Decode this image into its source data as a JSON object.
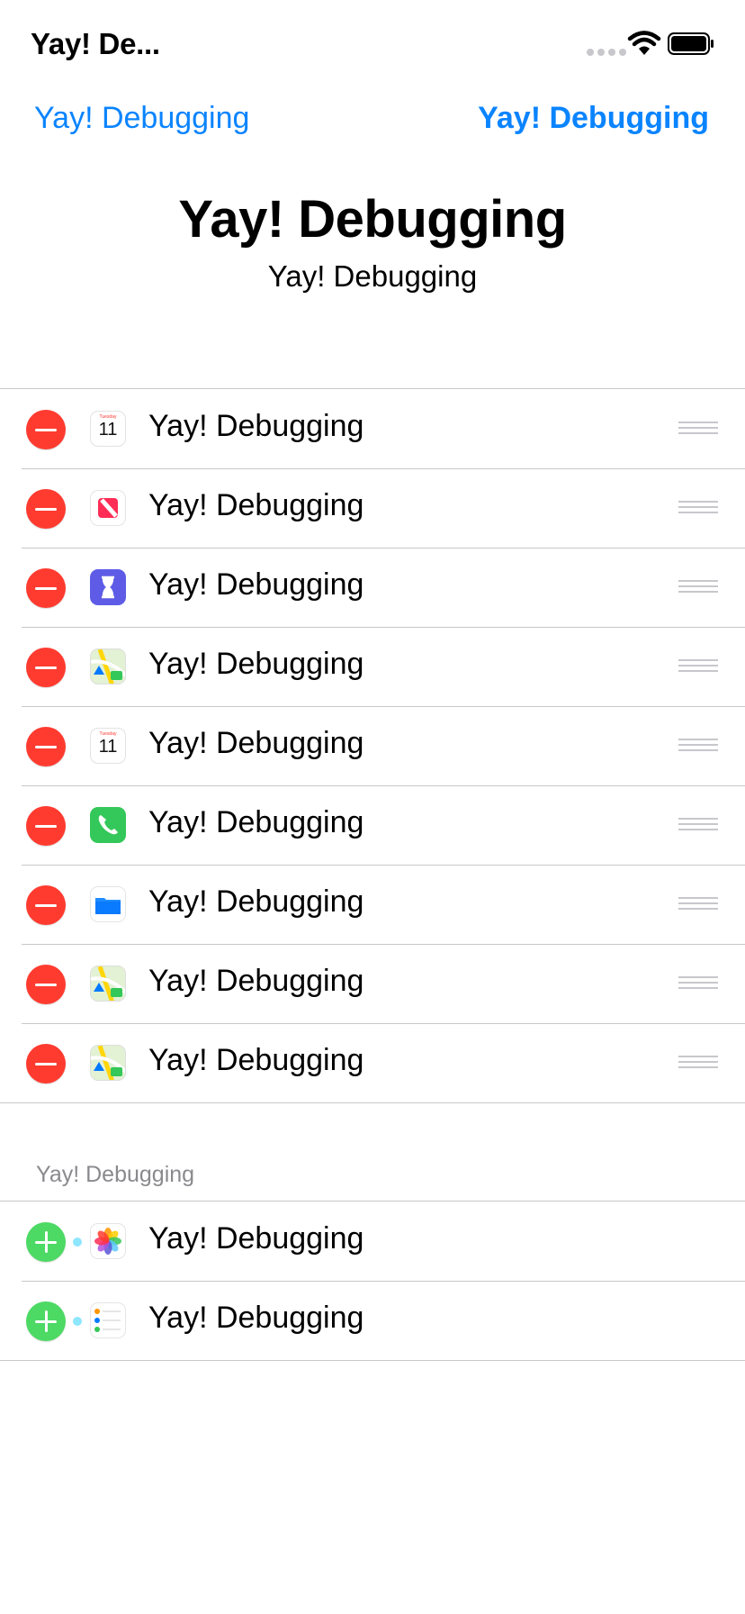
{
  "status_bar": {
    "title": "Yay! De..."
  },
  "nav": {
    "left_label": "Yay! Debugging",
    "right_label": "Yay! Debugging"
  },
  "header": {
    "title": "Yay! Debugging",
    "subtitle": "Yay! Debugging"
  },
  "editable_list": {
    "items": [
      {
        "label": "Yay! Debugging",
        "icon": "calendar-icon",
        "day": "Tuesday",
        "date": "11"
      },
      {
        "label": "Yay! Debugging",
        "icon": "news-icon"
      },
      {
        "label": "Yay! Debugging",
        "icon": "screen-time-icon"
      },
      {
        "label": "Yay! Debugging",
        "icon": "maps-icon"
      },
      {
        "label": "Yay! Debugging",
        "icon": "calendar-icon",
        "day": "Tuesday",
        "date": "11"
      },
      {
        "label": "Yay! Debugging",
        "icon": "phone-icon"
      },
      {
        "label": "Yay! Debugging",
        "icon": "files-icon"
      },
      {
        "label": "Yay! Debugging",
        "icon": "maps-icon"
      },
      {
        "label": "Yay! Debugging",
        "icon": "maps-icon"
      }
    ]
  },
  "insert_section": {
    "header": "Yay! Debugging",
    "items": [
      {
        "label": "Yay! Debugging",
        "icon": "photos-icon"
      },
      {
        "label": "Yay! Debugging",
        "icon": "reminders-icon"
      }
    ]
  },
  "colors": {
    "accent": "#0a84ff",
    "delete": "#ff3b30",
    "insert": "#4cd964",
    "separator": "#c8c7cc"
  }
}
